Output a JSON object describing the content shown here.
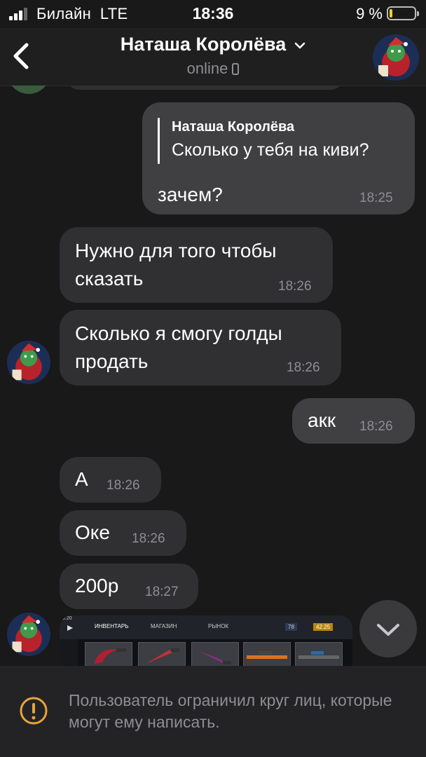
{
  "status_bar": {
    "carrier": "Билайн",
    "network": "LTE",
    "time": "18:36",
    "battery_percent": "9 %",
    "battery_level": 0.09
  },
  "header": {
    "contact_name": "Наташа Королёва",
    "presence": "online"
  },
  "messages": [
    {
      "direction": "outgoing",
      "reply_to": {
        "author": "Наташа Королёва",
        "text": "Сколько у тебя на киви?"
      },
      "text": "зачем?",
      "time": "18:25"
    },
    {
      "direction": "incoming",
      "lines": [
        "Нужно для того чтобы",
        "сказать"
      ],
      "time": "18:26"
    },
    {
      "direction": "incoming",
      "lines": [
        "Сколько я смогу голды",
        "продать"
      ],
      "time": "18:26"
    },
    {
      "direction": "outgoing",
      "text": "акк",
      "time": "18:26"
    },
    {
      "direction": "incoming",
      "text": "А",
      "time": "18:26"
    },
    {
      "direction": "incoming",
      "text": "Оке",
      "time": "18:26"
    },
    {
      "direction": "incoming",
      "text": "200р",
      "time": "18:27"
    },
    {
      "direction": "incoming",
      "attachment": {
        "type": "game-screenshot",
        "tabs": [
          "ИНВЕНТАРЬ",
          "МАГАЗИН",
          "РЫНОК"
        ],
        "status_time": "0:20",
        "balances": [
          "78",
          "42.25"
        ]
      }
    }
  ],
  "footer": {
    "notice": "Пользователь ограничил круг лиц, которые могут ему написать."
  },
  "icons": {
    "back": "chevron-left-icon",
    "dropdown": "chevron-down-icon",
    "device": "phone-icon",
    "scroll_down": "chevron-down-icon",
    "warning": "exclamation-circle-icon"
  },
  "colors": {
    "background": "#19191a",
    "incoming_bubble": "#303033",
    "outgoing_bubble": "#404043",
    "timestamp": "#8e8e93",
    "warning": "#e8a33d",
    "battery_low": "#f4cf2a"
  }
}
